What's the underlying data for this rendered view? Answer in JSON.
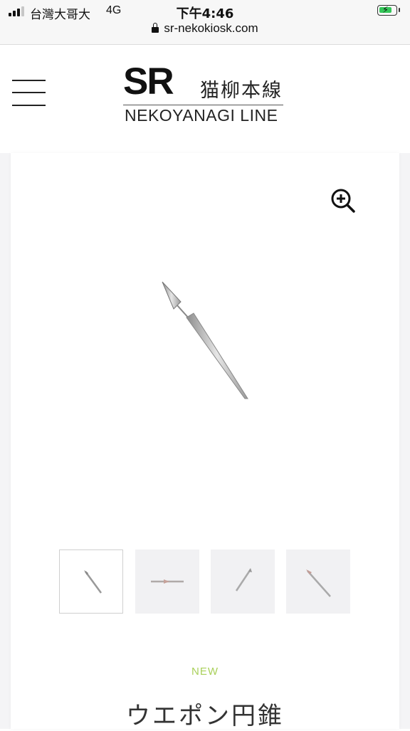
{
  "status_bar": {
    "carrier": "台灣大哥大",
    "network": "4G",
    "time": "下午4:46",
    "url": "sr-nekokiosk.com"
  },
  "header": {
    "logo_mark": "SR",
    "logo_japanese": "猫柳本線",
    "logo_english": "NEKOYANAGI LINE",
    "menu_icon": "hamburger-menu-icon"
  },
  "product": {
    "zoom_icon": "zoom-in-icon",
    "badge": "NEW",
    "title": "ウエポン円錐",
    "thumbnails_count": 4,
    "active_thumbnail": 1
  },
  "colors": {
    "badge": "#a9d05a",
    "battery_fill": "#34c759",
    "thumb_bg": "#f1f1f3",
    "page_bg": "#f4f4f6"
  }
}
